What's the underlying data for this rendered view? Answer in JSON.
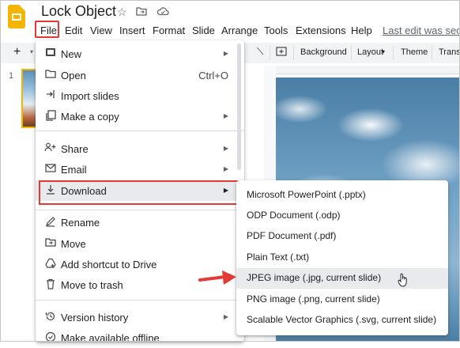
{
  "header": {
    "title": "Lock Object",
    "star_icon": "star-icon",
    "folder_icon": "move-folder-icon",
    "cloud_icon": "cloud-status-icon",
    "last_edit": "Last edit was seco"
  },
  "menubar": [
    "File",
    "Edit",
    "View",
    "Insert",
    "Format",
    "Slide",
    "Arrange",
    "Tools",
    "Extensions",
    "Help"
  ],
  "toolbar": {
    "add_label": "+",
    "background": "Background",
    "layout": "Layout",
    "theme": "Theme",
    "transition": "Transi"
  },
  "filmstrip": {
    "slide_number": "1"
  },
  "file_menu": {
    "items": [
      {
        "label": "New",
        "icon": "new-slides-icon",
        "submenu": true
      },
      {
        "label": "Open",
        "icon": "folder-open-icon",
        "shortcut": "Ctrl+O"
      },
      {
        "label": "Import slides",
        "icon": "import-icon"
      },
      {
        "label": "Make a copy",
        "icon": "copy-icon",
        "submenu": true
      },
      {
        "label": "Share",
        "icon": "share-person-icon",
        "submenu": true
      },
      {
        "label": "Email",
        "icon": "email-icon",
        "submenu": true
      },
      {
        "label": "Download",
        "icon": "download-icon",
        "submenu": true
      },
      {
        "label": "Rename",
        "icon": "rename-pencil-icon"
      },
      {
        "label": "Move",
        "icon": "move-folder-icon"
      },
      {
        "label": "Add shortcut to Drive",
        "icon": "drive-shortcut-icon"
      },
      {
        "label": "Move to trash",
        "icon": "trash-icon"
      },
      {
        "label": "Version history",
        "icon": "history-icon",
        "submenu": true
      },
      {
        "label": "Make available offline",
        "icon": "offline-icon"
      }
    ]
  },
  "download_menu": {
    "items": [
      "Microsoft PowerPoint (.pptx)",
      "ODP Document (.odp)",
      "PDF Document (.pdf)",
      "Plain Text (.txt)",
      "JPEG image (.jpg, current slide)",
      "PNG image (.png, current slide)",
      "Scalable Vector Graphics (.svg, current slide)"
    ]
  },
  "colors": {
    "highlight": "#e53935",
    "logo": "#f4b400"
  }
}
